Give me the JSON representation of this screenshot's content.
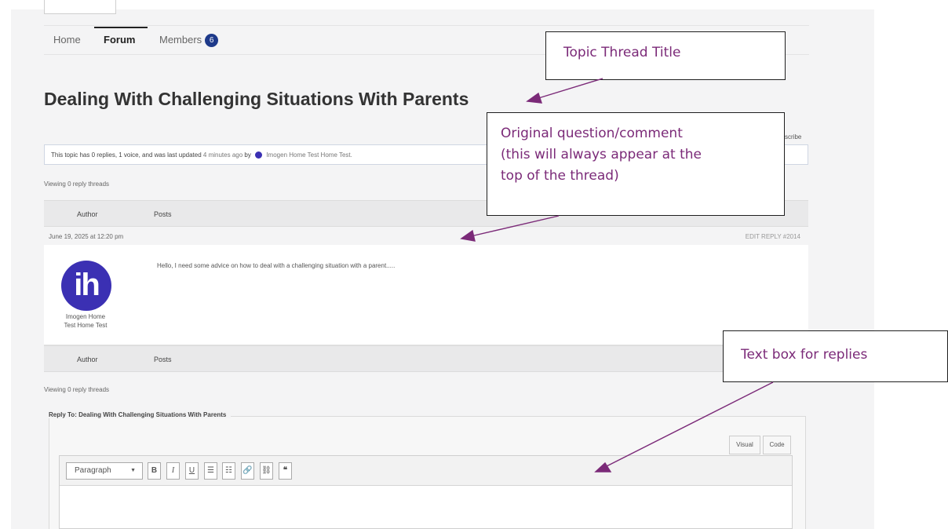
{
  "nav": {
    "items": [
      "Home",
      "Forum",
      "Members"
    ],
    "members_count": "6",
    "active": "Forum"
  },
  "topic": {
    "title": "Dealing With Challenging Situations With Parents",
    "subscribe_label": "scribe",
    "info_prefix": "This topic has 0 replies, 1 voice, and was last updated",
    "info_time": "4 minutes ago",
    "info_by": "by",
    "info_author": "Imogen Home Test Home Test."
  },
  "viewing_top": "Viewing 0 reply threads",
  "viewing_bottom": "Viewing 0 reply threads",
  "table": {
    "col_author": "Author",
    "col_posts": "Posts"
  },
  "post": {
    "date": "June 19, 2025 at 12:20 pm",
    "actions": "EDIT  REPLY  #2014",
    "author_initials": "ih",
    "author_name_line1": "Imogen Home",
    "author_name_line2": "Test Home Test",
    "text": "Hello, I need some advice on how to deal with a challenging situation with a parent....."
  },
  "reply": {
    "legend": "Reply To: Dealing With Challenging Situations With Parents",
    "tab_visual": "Visual",
    "tab_code": "Code",
    "toolbar": {
      "format": "Paragraph",
      "bold": "B",
      "italic": "I",
      "underline": "U",
      "bullet_list": "☰",
      "numbered_list": "☷",
      "link": "🔗",
      "unlink": "⛓",
      "quote": "❝"
    }
  },
  "callouts": {
    "title_callout": "Topic Thread Title",
    "original_line1": "Original question/comment",
    "original_line2": "(this will always appear at the",
    "original_line3": "top of the thread)",
    "reply_callout": "Text box for replies"
  },
  "colors": {
    "accent_text": "#7b2a78",
    "avatar": "#3b30b3",
    "badge": "#1e3a8a"
  }
}
